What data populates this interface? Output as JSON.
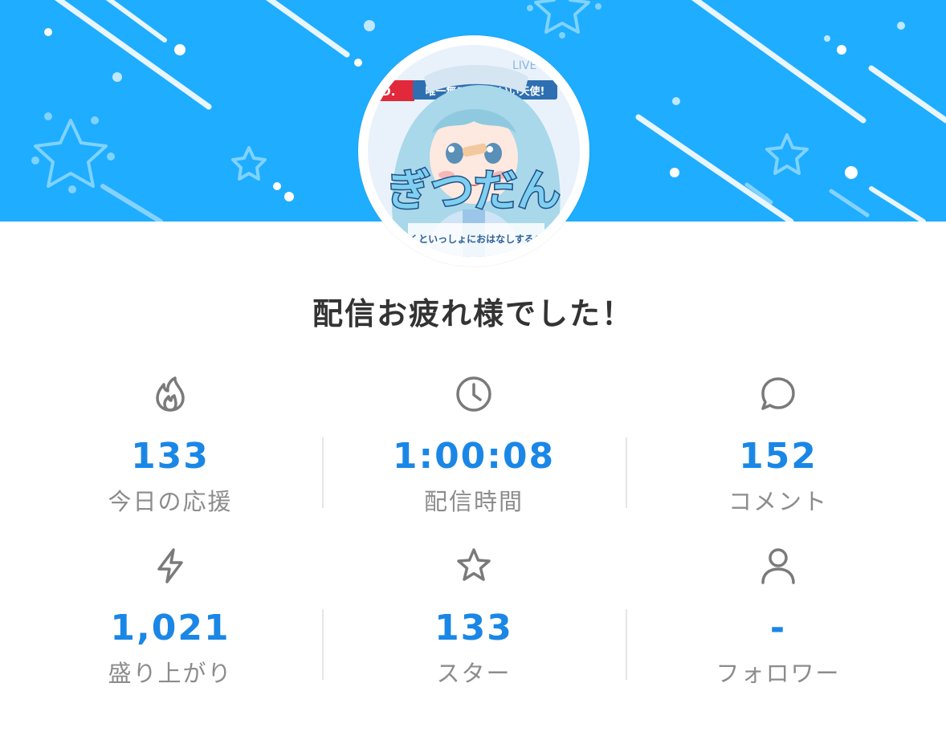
{
  "header": {
    "banner_color": "#1fadff",
    "avatar": {
      "badge_text": "唯一無二のかわいい天使!",
      "name_text": "ぎつだん",
      "caption_text": "ぼくといっしょにおはなしするのだ",
      "corner_text": "LIVE"
    }
  },
  "title": "配信お疲れ様でした！",
  "stats": [
    {
      "icon": "flame-icon",
      "value": "133",
      "label": "今日の応援"
    },
    {
      "icon": "clock-icon",
      "value": "1:00:08",
      "label": "配信時間"
    },
    {
      "icon": "comment-icon",
      "value": "152",
      "label": "コメント"
    },
    {
      "icon": "lightning-icon",
      "value": "1,021",
      "label": "盛り上がり"
    },
    {
      "icon": "star-icon",
      "value": "133",
      "label": "スター"
    },
    {
      "icon": "person-icon",
      "value": "-",
      "label": "フォロワー"
    }
  ],
  "colors": {
    "accent": "#1a87e6",
    "label": "#8c8c8c",
    "title": "#333333",
    "icon": "#7a7a7a"
  }
}
